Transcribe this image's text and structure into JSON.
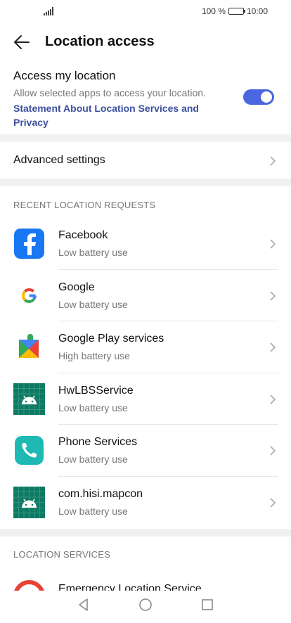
{
  "status_bar": {
    "battery_percent": "100 %",
    "time": "10:00"
  },
  "app_bar": {
    "title": "Location access"
  },
  "access": {
    "title": "Access my location",
    "subtitle": "Allow selected apps to access your location.",
    "link": "Statement About Location Services and Privacy",
    "enabled": true
  },
  "advanced": {
    "label": "Advanced settings"
  },
  "recent": {
    "header": "RECENT LOCATION REQUESTS",
    "apps": [
      {
        "name": "Facebook",
        "usage": "Low battery use",
        "icon": "facebook-icon"
      },
      {
        "name": "Google",
        "usage": "Low battery use",
        "icon": "google-icon"
      },
      {
        "name": "Google Play services",
        "usage": "High battery use",
        "icon": "google-play-services-icon"
      },
      {
        "name": "HwLBSService",
        "usage": "Low battery use",
        "icon": "android-icon"
      },
      {
        "name": "Phone Services",
        "usage": "Low battery use",
        "icon": "phone-icon"
      },
      {
        "name": "com.hisi.mapcon",
        "usage": "Low battery use",
        "icon": "android-icon"
      }
    ]
  },
  "services": {
    "header": "LOCATION SERVICES",
    "partial_item": "Emergency Location Service"
  },
  "colors": {
    "accent": "#4a66e0",
    "link": "#3c4fa0",
    "divider_band": "#f1f1f1"
  }
}
